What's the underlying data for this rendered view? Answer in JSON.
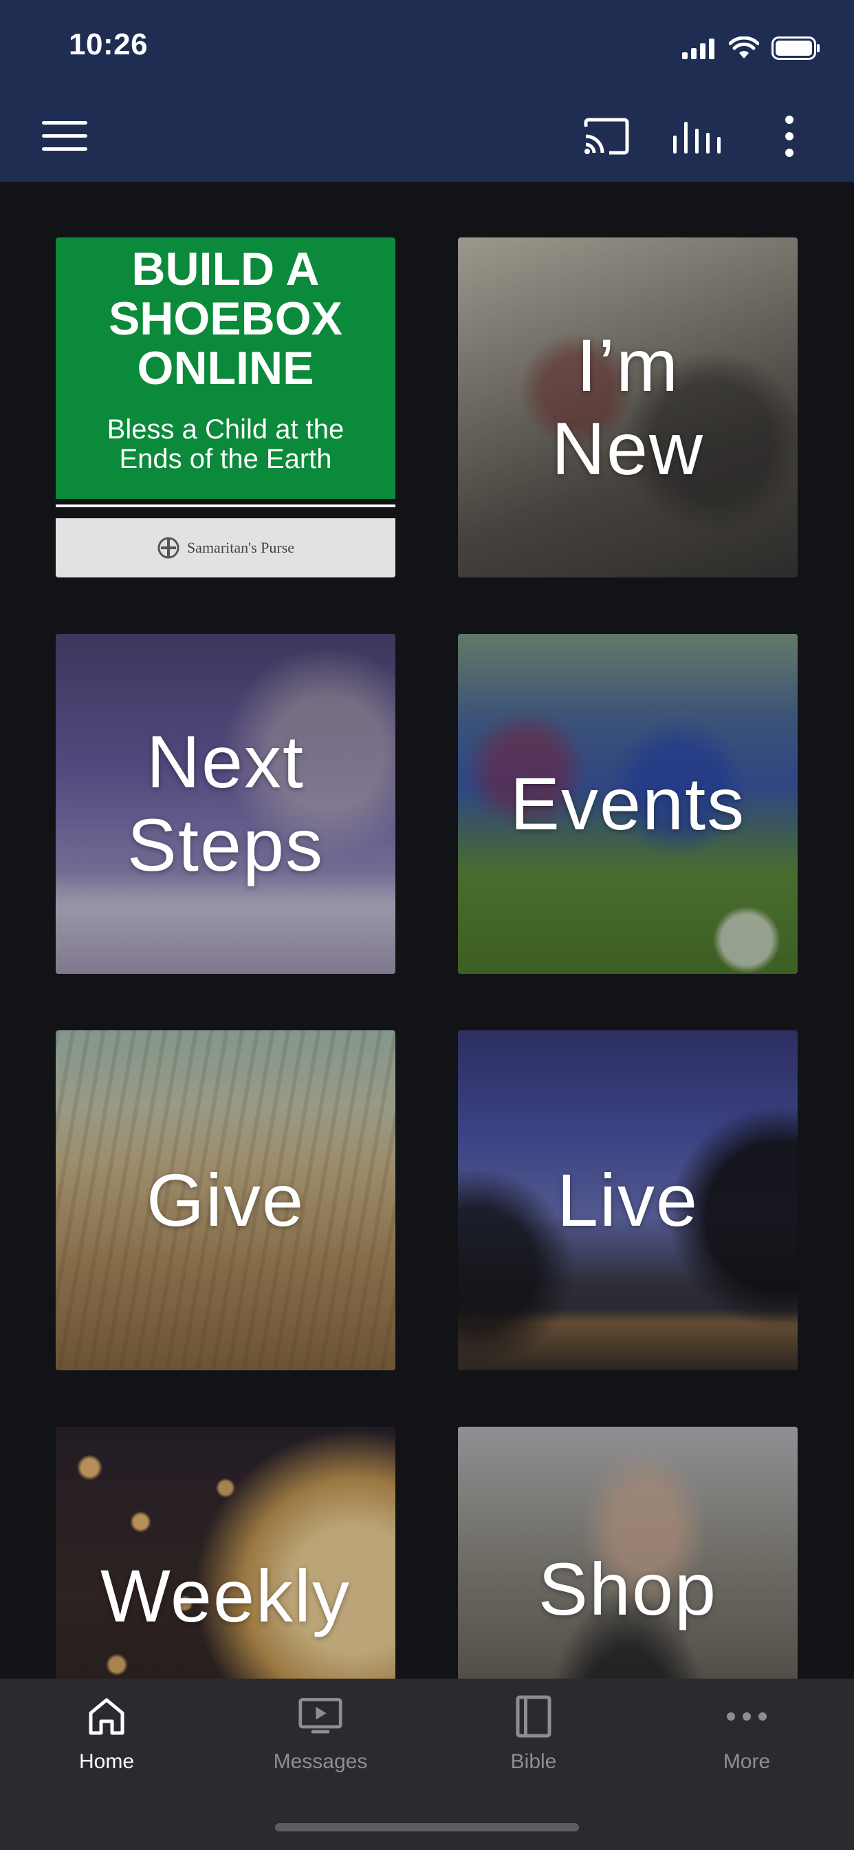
{
  "status_bar": {
    "time": "10:26"
  },
  "header": {
    "menu_icon": "hamburger-menu-icon",
    "cast_icon": "cast-icon",
    "audio_icon": "audio-bars-icon",
    "more_icon": "vertical-dots-icon",
    "background_color": "#1f2d53"
  },
  "tiles": [
    {
      "id": "shoebox",
      "title": "BUILD A\nSHOEBOX\nONLINE",
      "subtitle": "Bless a Child at the\nEnds of the Earth",
      "logo_text": "Samaritan's Purse",
      "color": "#0a8a3a"
    },
    {
      "id": "im-new",
      "label": "I’m\nNew"
    },
    {
      "id": "next-steps",
      "label": "Next\nSteps"
    },
    {
      "id": "events",
      "label": "Events"
    },
    {
      "id": "give",
      "label": "Give"
    },
    {
      "id": "live",
      "label": "Live"
    },
    {
      "id": "weekly",
      "label": "Weekly"
    },
    {
      "id": "shop",
      "label": "Shop"
    }
  ],
  "bottom_nav": {
    "items": [
      {
        "label": "Home",
        "icon": "home-icon",
        "active": true
      },
      {
        "label": "Messages",
        "icon": "video-screen-icon",
        "active": false
      },
      {
        "label": "Bible",
        "icon": "book-icon",
        "active": false
      },
      {
        "label": "More",
        "icon": "horizontal-dots-icon",
        "active": false
      }
    ]
  }
}
